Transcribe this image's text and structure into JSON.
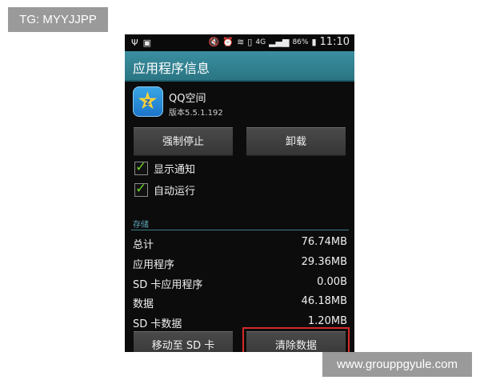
{
  "watermark": {
    "tag": "TG: MYYJJPP",
    "url": "www.grouppgyule.com"
  },
  "statusbar": {
    "icons_left": [
      "usb-icon",
      "image-icon"
    ],
    "icons_right": [
      "mute-icon",
      "alarm-icon",
      "wifi-icon",
      "sim-icon",
      "network-4g-icon",
      "signal-icon",
      "battery-icon"
    ],
    "network": "4G",
    "battery": "86%",
    "time": "11:10"
  },
  "titlebar": {
    "title": "应用程序信息"
  },
  "app": {
    "name": "QQ空间",
    "version": "版本5.5.1.192",
    "icon": "qzone-star-icon"
  },
  "buttons": {
    "force_stop": "强制停止",
    "uninstall": "卸载",
    "move_to_sd": "移动至 SD 卡",
    "clear_data": "清除数据"
  },
  "checks": [
    {
      "label": "显示通知",
      "checked": true
    },
    {
      "label": "自动运行",
      "checked": true
    }
  ],
  "storage": {
    "header": "存储",
    "rows": [
      {
        "label": "总计",
        "value": "76.74MB"
      },
      {
        "label": "应用程序",
        "value": "29.36MB"
      },
      {
        "label": "SD 卡应用程序",
        "value": "0.00B"
      },
      {
        "label": "数据",
        "value": "46.18MB"
      },
      {
        "label": "SD 卡数据",
        "value": "1.20MB"
      }
    ]
  },
  "colors": {
    "titlebar": "#2a7584",
    "accent": "#5aa6b8",
    "check": "#6fd028",
    "highlight": "#d52a2a"
  }
}
